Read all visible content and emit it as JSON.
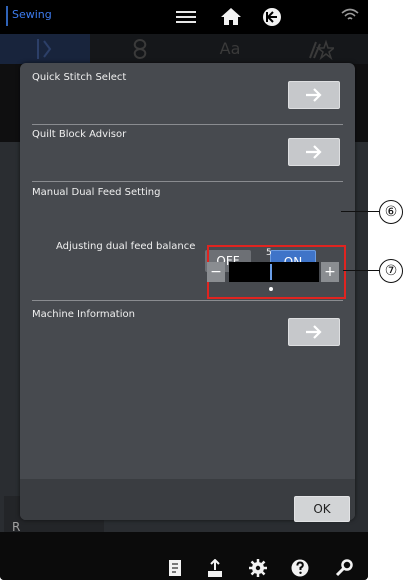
{
  "topbar": {
    "brand": "Sewing",
    "icons": [
      "menu-icon",
      "home-icon",
      "back-icon",
      "wifi-icon"
    ]
  },
  "tabs": [
    {
      "icon": "needle-icon"
    },
    {
      "icon": "pattern-icon"
    },
    {
      "label": "Aa"
    },
    {
      "icon": "stitch-favorite-icon"
    }
  ],
  "dialog": {
    "quick_stitch": {
      "label": "Quick Stitch Select",
      "button": "→"
    },
    "quilt_block": {
      "label": "Quilt Block Advisor",
      "button": "→"
    },
    "dual_feed": {
      "label": "Manual Dual Feed Setting",
      "off": "OFF",
      "on": "ON"
    },
    "dual_balance": {
      "label": "Adjusting dual feed balance",
      "value": "5",
      "minus": "−",
      "plus": "+"
    },
    "machine_info": {
      "label": "Machine Information",
      "button": "→"
    },
    "ok": "OK"
  },
  "left_stub": {
    "label": "R"
  },
  "callouts": [
    "⑥",
    "⑦"
  ],
  "bottom_icons": [
    "stitch-book-icon",
    "upload-icon",
    "settings-icon",
    "help-icon",
    "wrench-icon"
  ],
  "colors": {
    "accent": "#3f74c8",
    "callout_border": "#e02420"
  }
}
